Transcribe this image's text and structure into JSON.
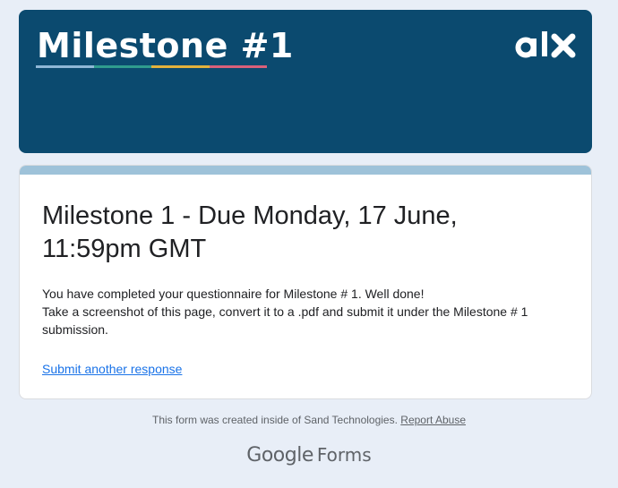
{
  "banner": {
    "title": "Milestone #1",
    "logo_icon": "alx-logo-icon",
    "background": "#0b4a6f"
  },
  "card": {
    "title": "Milestone 1 - Due Monday, 17 June, 11:59pm GMT",
    "message_line1": "You have completed your questionnaire for Milestone # 1. Well done!",
    "message_line2": "Take a screenshot of this page, convert it to a .pdf and submit it under the Milestone # 1 submission.",
    "submit_another_label": "Submit another response",
    "accent_color": "#9ec2d9",
    "link_color": "#1a73e8"
  },
  "footer": {
    "notice": "This form was created inside of Sand Technologies.",
    "report_label": "Report Abuse"
  },
  "brand": {
    "google": "Google",
    "forms": "Forms"
  }
}
